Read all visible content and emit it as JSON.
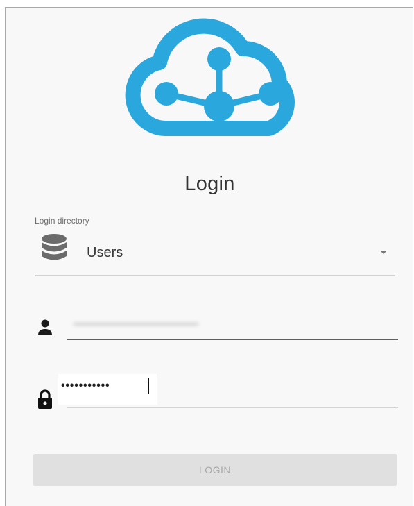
{
  "login": {
    "title": "Login",
    "directory": {
      "label": "Login directory",
      "value": "Users",
      "icon": "database-icon"
    },
    "username": {
      "value": "————————————",
      "icon": "person-icon"
    },
    "password": {
      "value": "•••••••••••",
      "icon": "lock-icon"
    },
    "submit_label": "LOGIN"
  },
  "colors": {
    "brand": "#2aa8de",
    "error_underline": "#d0302f",
    "disabled_button": "#e0e0e0",
    "disabled_text": "#a9a9a9"
  }
}
